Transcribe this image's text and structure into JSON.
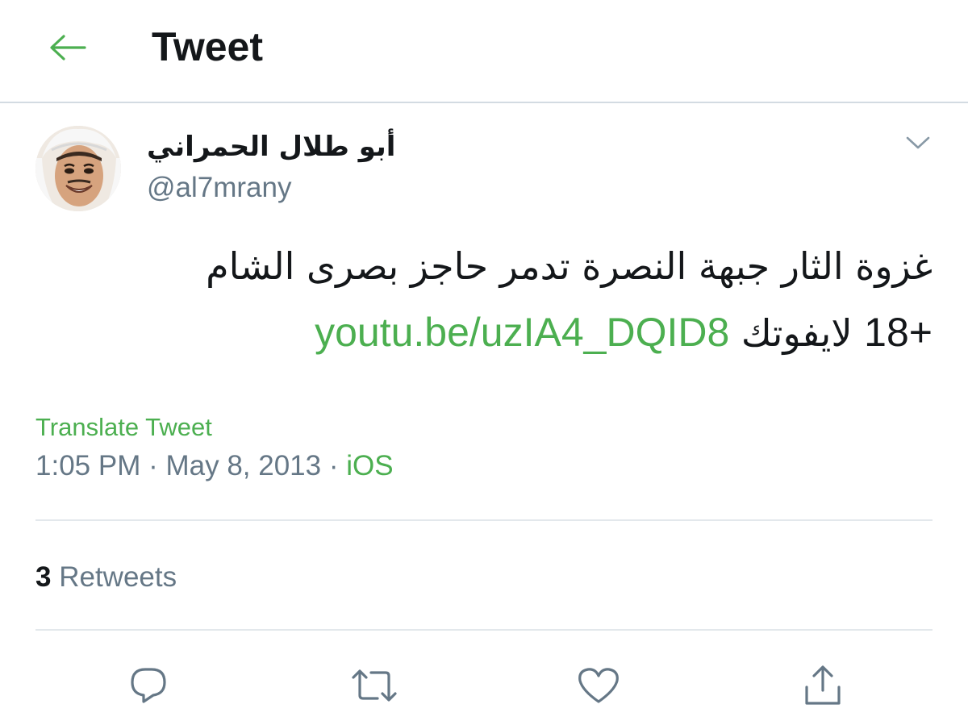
{
  "header": {
    "back_icon": "arrow-left-icon",
    "title": "Tweet"
  },
  "tweet": {
    "author": {
      "display_name": "أبو طلال الحمراني",
      "handle": "@al7mrany",
      "avatar": "avatar-photo"
    },
    "caret_icon": "chevron-down-icon",
    "text_line1": "غزوة الثار جبهة النصرة تدمر حاجز بصرى الشام",
    "text_line2_plus": "18+",
    "text_line2_word": "لايفوتك",
    "link": "youtu.be/uzIA4_DQID8",
    "translate_label": "Translate Tweet",
    "time": "1:05 PM",
    "separator": "·",
    "date": "May 8, 2013",
    "source": "iOS"
  },
  "stats": {
    "retweet_count": "3",
    "retweet_label": "Retweets"
  },
  "actions": [
    {
      "name": "reply",
      "icon": "reply-icon"
    },
    {
      "name": "retweet",
      "icon": "retweet-icon"
    },
    {
      "name": "like",
      "icon": "heart-icon"
    },
    {
      "name": "share",
      "icon": "share-icon"
    }
  ],
  "colors": {
    "accent": "#4caf50",
    "text": "#14171a",
    "secondary": "#657786",
    "divider": "#e3e8ec"
  }
}
